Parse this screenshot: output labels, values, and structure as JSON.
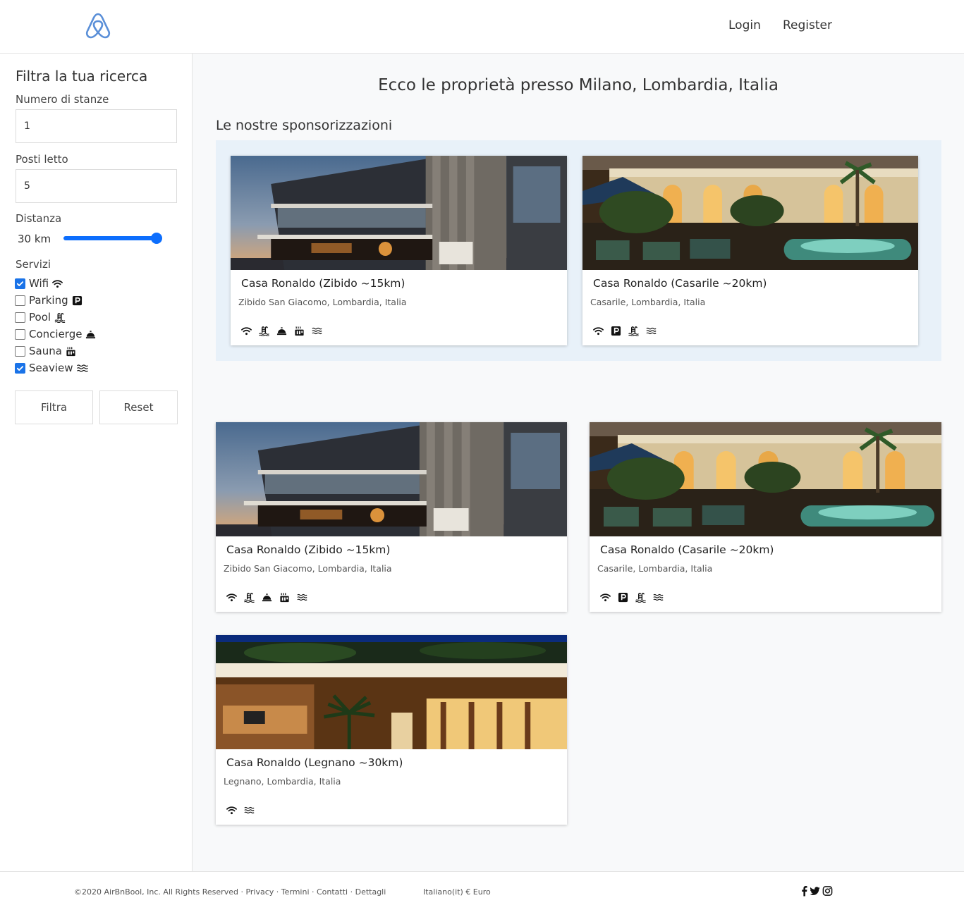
{
  "header": {
    "login_label": "Login",
    "register_label": "Register",
    "brand_color": "#5a8fd8"
  },
  "filters": {
    "title": "Filtra la tua ricerca",
    "rooms_label": "Numero di stanze",
    "rooms_value": "1",
    "beds_label": "Posti letto",
    "beds_value": "5",
    "distance_label": "Distanza",
    "distance_value": "30 km",
    "distance_slider_fraction": 1.0,
    "services_label": "Servizi",
    "services": [
      {
        "label": "Wifi",
        "icon": "wifi-icon",
        "checked": true
      },
      {
        "label": "Parking",
        "icon": "parking-icon",
        "checked": false
      },
      {
        "label": "Pool",
        "icon": "pool-icon",
        "checked": false
      },
      {
        "label": "Concierge",
        "icon": "concierge-bell-icon",
        "checked": false
      },
      {
        "label": "Sauna",
        "icon": "sauna-icon",
        "checked": false
      },
      {
        "label": "Seaview",
        "icon": "water-icon",
        "checked": true
      }
    ],
    "filter_button": "Filtra",
    "reset_button": "Reset",
    "accent_color": "#0d6efd"
  },
  "main": {
    "title": "Ecco le proprietà presso Milano, Lombardia, Italia",
    "sponsored_title": "Le nostre sponsorizzazioni",
    "sponsored": [
      {
        "title": "Casa Ronaldo (Zibido ~15km)",
        "address": "Zibido San Giacomo, Lombardia, Italia",
        "icons": [
          "wifi-icon",
          "pool-icon",
          "concierge-bell-icon",
          "sauna-icon",
          "water-icon"
        ]
      },
      {
        "title": "Casa Ronaldo (Casarile ~20km)",
        "address": "Casarile, Lombardia, Italia",
        "icons": [
          "wifi-icon",
          "parking-icon",
          "pool-icon",
          "water-icon"
        ]
      }
    ],
    "results": [
      {
        "title": "Casa Ronaldo (Zibido ~15km)",
        "address": "Zibido San Giacomo, Lombardia, Italia",
        "icons": [
          "wifi-icon",
          "pool-icon",
          "concierge-bell-icon",
          "sauna-icon",
          "water-icon"
        ]
      },
      {
        "title": "Casa Ronaldo (Casarile ~20km)",
        "address": "Casarile, Lombardia, Italia",
        "icons": [
          "wifi-icon",
          "parking-icon",
          "pool-icon",
          "water-icon"
        ]
      },
      {
        "title": "Casa Ronaldo (Legnano ~30km)",
        "address": "Legnano, Lombardia, Italia",
        "icons": [
          "wifi-icon",
          "water-icon"
        ]
      }
    ]
  },
  "footer": {
    "copyright": "©2020 AirBnBool, Inc. All Rights Reserved · Privacy · Termini · Contatti · Dettagli",
    "locale": "Italiano(it) € Euro",
    "social_icons": [
      "facebook-icon",
      "twitter-icon",
      "instagram-icon"
    ]
  }
}
